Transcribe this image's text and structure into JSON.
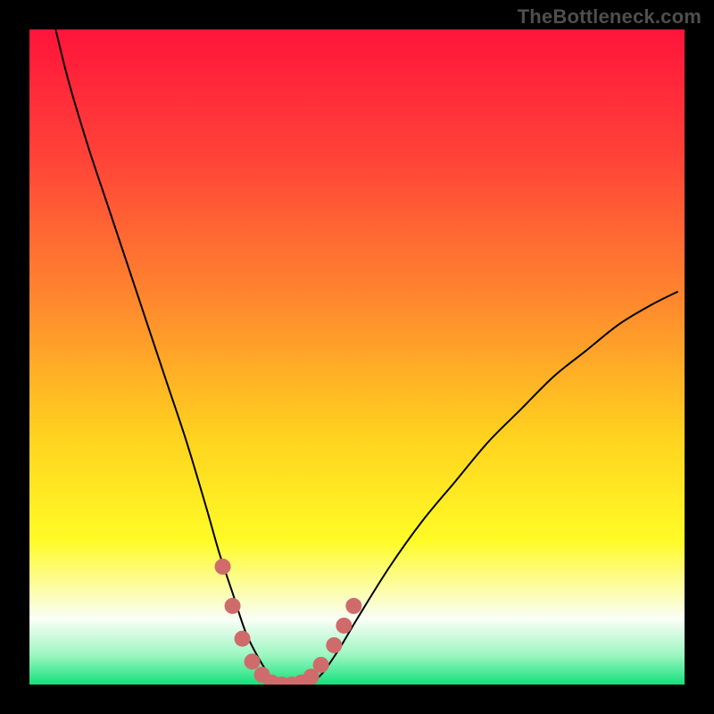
{
  "watermark": "TheBottleneck.com",
  "chart_data": {
    "type": "line",
    "title": "",
    "xlabel": "",
    "ylabel": "",
    "xlim": [
      0,
      100
    ],
    "ylim": [
      0,
      100
    ],
    "series": [
      {
        "name": "bottleneck-curve",
        "x": [
          4,
          6,
          9,
          12,
          15,
          18,
          21,
          24,
          27,
          29,
          31,
          33,
          35,
          37,
          39,
          41,
          44,
          47,
          50,
          55,
          60,
          65,
          70,
          75,
          80,
          85,
          90,
          95,
          99
        ],
        "y": [
          100,
          92,
          82,
          73,
          64,
          55,
          46,
          37,
          27,
          20,
          14,
          8,
          4,
          1,
          0,
          0,
          1,
          5,
          10,
          18,
          25,
          31,
          37,
          42,
          47,
          51,
          55,
          58,
          60
        ]
      }
    ],
    "markers": {
      "name": "highlight-dots",
      "color": "#d06b6b",
      "points": [
        {
          "x": 29.5,
          "y": 18
        },
        {
          "x": 31.0,
          "y": 12
        },
        {
          "x": 32.5,
          "y": 7
        },
        {
          "x": 34.0,
          "y": 3.5
        },
        {
          "x": 35.5,
          "y": 1.5
        },
        {
          "x": 37.0,
          "y": 0.3
        },
        {
          "x": 38.5,
          "y": 0
        },
        {
          "x": 40.0,
          "y": 0
        },
        {
          "x": 41.5,
          "y": 0.3
        },
        {
          "x": 43.0,
          "y": 1.2
        },
        {
          "x": 44.5,
          "y": 3
        },
        {
          "x": 46.5,
          "y": 6
        },
        {
          "x": 48.0,
          "y": 9
        },
        {
          "x": 49.5,
          "y": 12
        }
      ]
    },
    "background_gradient": {
      "type": "vertical",
      "stops": [
        {
          "pos": 0.0,
          "color": "#ff143b"
        },
        {
          "pos": 0.2,
          "color": "#ff4438"
        },
        {
          "pos": 0.42,
          "color": "#ff8a2e"
        },
        {
          "pos": 0.62,
          "color": "#ffd21f"
        },
        {
          "pos": 0.78,
          "color": "#fffb26"
        },
        {
          "pos": 0.9,
          "color": "#fafef7"
        },
        {
          "pos": 0.955,
          "color": "#9cf7c1"
        },
        {
          "pos": 1.0,
          "color": "#14e07a"
        }
      ]
    }
  }
}
